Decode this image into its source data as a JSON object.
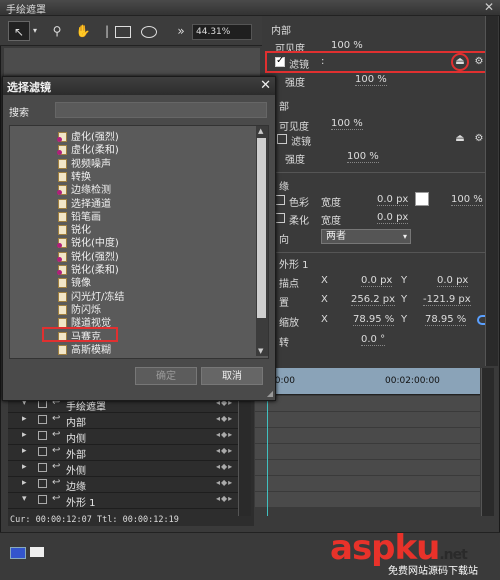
{
  "window": {
    "title": "手绘遮罩",
    "close": "✕"
  },
  "toolbar": {
    "tools": [
      "select-arrow",
      "magnify",
      "hand-pan",
      "rectangle",
      "ellipse",
      "wand"
    ],
    "zoom": "44.31%"
  },
  "right_panel": {
    "inner_section": "内部",
    "visibility_label": "可见度",
    "visibility_value": "100 %",
    "filter_label": "滤镜",
    "filter_colon": ":",
    "strength_label": "强度",
    "strength_value": "100 %",
    "outer_section": "部",
    "outer_visibility_label": "可见度",
    "outer_visibility_value": "100 %",
    "outer_filter_label": "滤镜",
    "outer_strength_label": "强度",
    "outer_strength_value": "100 %",
    "edge_section": "缘",
    "color_label": "色彩",
    "color_width_label": "宽度",
    "color_width_value": "0.0 px",
    "color_percent": "100 %",
    "feather_label": "柔化",
    "feather_width_label": "宽度",
    "feather_width_value": "0.0 px",
    "direction_label": "向",
    "direction_value": "两者",
    "shape_section": "外形 1",
    "anchor_label": "描点",
    "anchor_x": "0.0 px",
    "anchor_y": "0.0 px",
    "position_label": "置",
    "position_x": "256.2 px",
    "position_y": "-121.9 px",
    "scale_label": "缩放",
    "scale_x": "78.95 %",
    "scale_y": "78.95 %",
    "rotate_label": "转",
    "rotate_value": "0.0 °",
    "x_label": "X",
    "y_label": "Y"
  },
  "timeline": {
    "ticks": [
      "00:00",
      "00:02:00:00"
    ],
    "tracks": [
      {
        "name": "手绘遮罩"
      },
      {
        "name": "内部"
      },
      {
        "name": "内侧"
      },
      {
        "name": "外部"
      },
      {
        "name": "外侧"
      },
      {
        "name": "边缘"
      },
      {
        "name": "外形 1"
      }
    ],
    "status": "Cur: 00:00:12:07  Ttl: 00:00:12:19"
  },
  "dialog": {
    "title": "选择滤镜",
    "close": "✕",
    "search_label": "搜索",
    "search_value": "",
    "items": [
      {
        "label": "虚化(强烈)",
        "icon": "purple"
      },
      {
        "label": "虚化(柔和)",
        "icon": "purple"
      },
      {
        "label": "视频噪声",
        "icon": "plain"
      },
      {
        "label": "转换",
        "icon": "plain"
      },
      {
        "label": "边缘检测",
        "icon": "purple"
      },
      {
        "label": "选择通道",
        "icon": "plain"
      },
      {
        "label": "铅笔画",
        "icon": "plain"
      },
      {
        "label": "锐化",
        "icon": "plain"
      },
      {
        "label": "锐化(中度)",
        "icon": "purple"
      },
      {
        "label": "锐化(强烈)",
        "icon": "purple"
      },
      {
        "label": "锐化(柔和)",
        "icon": "purple"
      },
      {
        "label": "镜像",
        "icon": "plain"
      },
      {
        "label": "闪光灯/冻结",
        "icon": "plain"
      },
      {
        "label": "防闪烁",
        "icon": "plain"
      },
      {
        "label": "隧道视觉",
        "icon": "plain"
      },
      {
        "label": "马赛克",
        "icon": "plain"
      },
      {
        "label": "高斯模糊",
        "icon": "plain"
      }
    ],
    "selected_index": 15,
    "ok": "确定",
    "cancel": "取消"
  },
  "watermark": {
    "brand": "aspku",
    "tld": ".net",
    "sub": "免费网站源码下载站"
  },
  "colors": {
    "highlight": "#e03030",
    "playhead": "#40c0c0",
    "ruler": "#8aa3b8"
  }
}
